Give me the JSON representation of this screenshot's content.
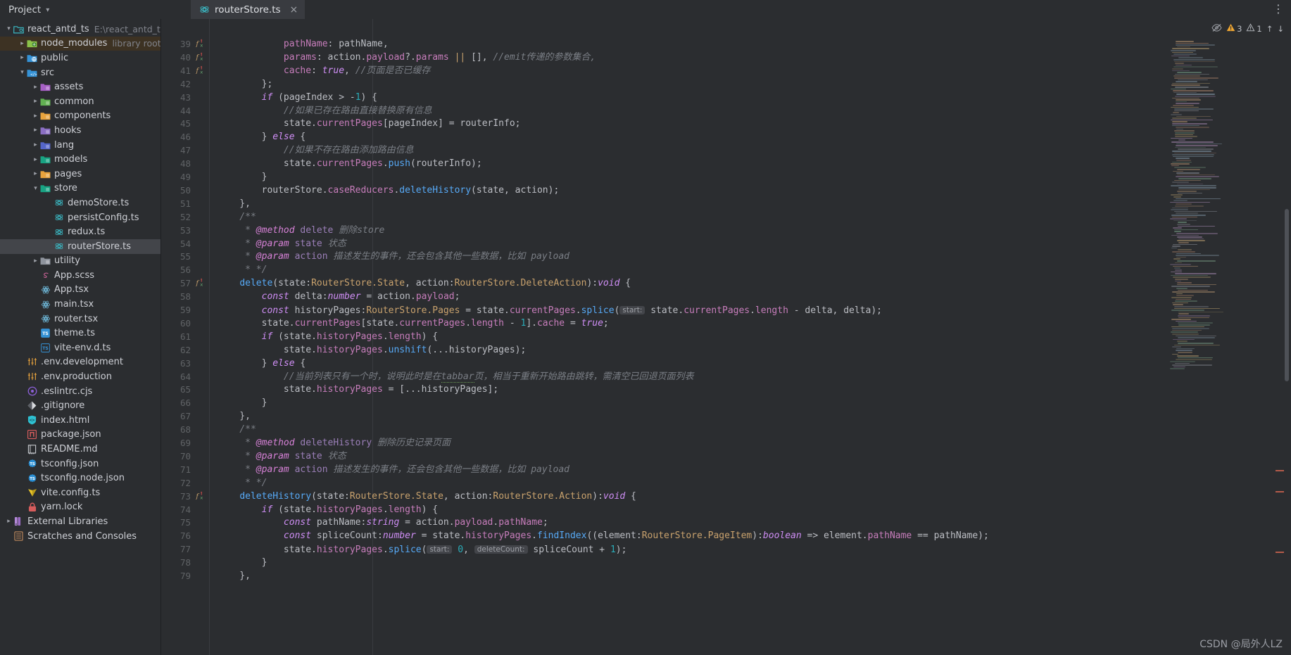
{
  "window": {
    "project_panel_title": "Project",
    "project_panel_chevron": "chevron-down",
    "menu_icon": "vertical-dots"
  },
  "tab": {
    "label": "routerStore.ts",
    "close_label": "×",
    "icon": "redux-icon"
  },
  "sidebar": {
    "items": [
      {
        "label": "react_antd_ts",
        "sub": "E:\\react_antd_ts",
        "depth": 0,
        "arrow": "open",
        "icon": "project-root",
        "color": "#3bb8c3",
        "state": ""
      },
      {
        "label": "node_modules",
        "sub": "library root",
        "depth": 1,
        "arrow": "closed",
        "icon": "folder-node",
        "color": "#8cc24a",
        "state": "hl-brown"
      },
      {
        "label": "public",
        "sub": "",
        "depth": 1,
        "arrow": "closed",
        "icon": "folder-public",
        "color": "#3592d6",
        "state": ""
      },
      {
        "label": "src",
        "sub": "",
        "depth": 1,
        "arrow": "open",
        "icon": "folder-src",
        "color": "#3592d6",
        "state": ""
      },
      {
        "label": "assets",
        "sub": "",
        "depth": 2,
        "arrow": "closed",
        "icon": "folder",
        "color": "#a660c4",
        "state": ""
      },
      {
        "label": "common",
        "sub": "",
        "depth": 2,
        "arrow": "closed",
        "icon": "folder",
        "color": "#62b152",
        "state": ""
      },
      {
        "label": "components",
        "sub": "",
        "depth": 2,
        "arrow": "closed",
        "icon": "folder",
        "color": "#e8a33d",
        "state": ""
      },
      {
        "label": "hooks",
        "sub": "",
        "depth": 2,
        "arrow": "closed",
        "icon": "folder",
        "color": "#8b6fc4",
        "state": ""
      },
      {
        "label": "lang",
        "sub": "",
        "depth": 2,
        "arrow": "closed",
        "icon": "folder",
        "color": "#5566c9",
        "state": ""
      },
      {
        "label": "models",
        "sub": "",
        "depth": 2,
        "arrow": "closed",
        "icon": "folder",
        "color": "#18a383",
        "state": ""
      },
      {
        "label": "pages",
        "sub": "",
        "depth": 2,
        "arrow": "closed",
        "icon": "folder",
        "color": "#e8a33d",
        "state": ""
      },
      {
        "label": "store",
        "sub": "",
        "depth": 2,
        "arrow": "open",
        "icon": "folder",
        "color": "#18a383",
        "state": ""
      },
      {
        "label": "demoStore.ts",
        "sub": "",
        "depth": 3,
        "arrow": "none",
        "icon": "redux-icon",
        "color": "#3bb8c3",
        "state": ""
      },
      {
        "label": "persistConfig.ts",
        "sub": "",
        "depth": 3,
        "arrow": "none",
        "icon": "redux-icon",
        "color": "#3bb8c3",
        "state": ""
      },
      {
        "label": "redux.ts",
        "sub": "",
        "depth": 3,
        "arrow": "none",
        "icon": "redux-icon",
        "color": "#3bb8c3",
        "state": ""
      },
      {
        "label": "routerStore.ts",
        "sub": "",
        "depth": 3,
        "arrow": "none",
        "icon": "redux-icon",
        "color": "#3bb8c3",
        "state": "selected"
      },
      {
        "label": "utility",
        "sub": "",
        "depth": 2,
        "arrow": "closed",
        "icon": "folder",
        "color": "#8e939c",
        "state": ""
      },
      {
        "label": "App.scss",
        "sub": "",
        "depth": 2,
        "arrow": "none",
        "icon": "sass-icon",
        "color": "#cf649a",
        "state": ""
      },
      {
        "label": "App.tsx",
        "sub": "",
        "depth": 2,
        "arrow": "none",
        "icon": "react-icon",
        "color": "#6fb8d9",
        "state": ""
      },
      {
        "label": "main.tsx",
        "sub": "",
        "depth": 2,
        "arrow": "none",
        "icon": "react-icon",
        "color": "#6fb8d9",
        "state": ""
      },
      {
        "label": "router.tsx",
        "sub": "",
        "depth": 2,
        "arrow": "none",
        "icon": "react-icon",
        "color": "#6fb8d9",
        "state": ""
      },
      {
        "label": "theme.ts",
        "sub": "",
        "depth": 2,
        "arrow": "none",
        "icon": "ts-icon",
        "color": "#3592d6",
        "state": ""
      },
      {
        "label": "vite-env.d.ts",
        "sub": "",
        "depth": 2,
        "arrow": "none",
        "icon": "ts-decl-icon",
        "color": "#3592d6",
        "state": ""
      },
      {
        "label": ".env.development",
        "sub": "",
        "depth": 1,
        "arrow": "none",
        "icon": "env-icon",
        "color": "#e8a33d",
        "state": ""
      },
      {
        "label": ".env.production",
        "sub": "",
        "depth": 1,
        "arrow": "none",
        "icon": "env-icon",
        "color": "#e8a33d",
        "state": ""
      },
      {
        "label": ".eslintrc.cjs",
        "sub": "",
        "depth": 1,
        "arrow": "none",
        "icon": "eslint-icon",
        "color": "#8b5fd6",
        "state": ""
      },
      {
        "label": ".gitignore",
        "sub": "",
        "depth": 1,
        "arrow": "none",
        "icon": "git-icon",
        "color": "#d7d9dd",
        "state": ""
      },
      {
        "label": "index.html",
        "sub": "",
        "depth": 1,
        "arrow": "none",
        "icon": "html-icon",
        "color": "#2ebfd0",
        "state": ""
      },
      {
        "label": "package.json",
        "sub": "",
        "depth": 1,
        "arrow": "none",
        "icon": "npm-icon",
        "color": "#d65c5c",
        "state": ""
      },
      {
        "label": "README.md",
        "sub": "",
        "depth": 1,
        "arrow": "none",
        "icon": "readme-icon",
        "color": "#c6c9ce",
        "state": ""
      },
      {
        "label": "tsconfig.json",
        "sub": "",
        "depth": 1,
        "arrow": "none",
        "icon": "tsconfig-icon",
        "color": "#2a8fd4",
        "state": ""
      },
      {
        "label": "tsconfig.node.json",
        "sub": "",
        "depth": 1,
        "arrow": "none",
        "icon": "tsconfig-icon",
        "color": "#2a8fd4",
        "state": ""
      },
      {
        "label": "vite.config.ts",
        "sub": "",
        "depth": 1,
        "arrow": "none",
        "icon": "vite-icon",
        "color": "#e6c229",
        "state": ""
      },
      {
        "label": "yarn.lock",
        "sub": "",
        "depth": 1,
        "arrow": "none",
        "icon": "lock-icon",
        "color": "#d65c5c",
        "state": ""
      },
      {
        "label": "External Libraries",
        "sub": "",
        "depth": 0,
        "arrow": "closed",
        "icon": "library-icon",
        "color": "#b488d9",
        "state": ""
      },
      {
        "label": "Scratches and Consoles",
        "sub": "",
        "depth": 0,
        "arrow": "none",
        "icon": "scratch-icon",
        "color": "#c08a5e",
        "state": ""
      }
    ]
  },
  "inspection": {
    "eye_icon": "eye-off-icon",
    "warning_icon": "warning-triangle-icon",
    "warning_count": "3",
    "weak_warning_icon": "weak-warning-icon",
    "weak_warning_count": "1",
    "up_arrow": "↑",
    "down_arrow": "↓"
  },
  "watermark": "CSDN @局外人LZ",
  "editor": {
    "first_line": 39,
    "lines": [
      {
        "n": 39,
        "mark": "fx",
        "html": "<span class='pln'>            </span><span class='prop'>pathName</span><span class='pln'>: pathName,</span>"
      },
      {
        "n": 40,
        "mark": "fx",
        "html": "<span class='pln'>            </span><span class='prop'>params</span><span class='pln'>: action.</span><span class='prop'>payload</span><span class='pln'>?.</span><span class='prop'>params</span><span class='pln'> </span><span class='var'>||</span><span class='pln'> [], </span><span class='com'>//emit传递的参数集合,</span>"
      },
      {
        "n": 41,
        "mark": "fx",
        "html": "<span class='pln'>            </span><span class='prop'>cache</span><span class='pln'>: </span><span class='kw'>true</span><span class='pln'>, </span><span class='com'>//页面是否已缓存</span>"
      },
      {
        "n": 42,
        "mark": "",
        "html": "<span class='pln'>        };</span>"
      },
      {
        "n": 43,
        "mark": "",
        "html": "<span class='pln'>        </span><span class='kw'>if</span><span class='pln'> (pageIndex &gt; -</span><span class='num2'>1</span><span class='pln'>) {</span>"
      },
      {
        "n": 44,
        "mark": "",
        "html": "<span class='pln'>            </span><span class='com'>//如果已存在路由直接替换原有信息</span>"
      },
      {
        "n": 45,
        "mark": "",
        "html": "<span class='pln'>            state.</span><span class='prop'>currentPages</span><span class='pln'>[pageIndex] = routerInfo;</span>"
      },
      {
        "n": 46,
        "mark": "",
        "html": "<span class='pln'>        } </span><span class='kw'>else</span><span class='pln'> {</span>"
      },
      {
        "n": 47,
        "mark": "",
        "html": "<span class='pln'>            </span><span class='com'>//如果不存在路由添加路由信息</span>"
      },
      {
        "n": 48,
        "mark": "",
        "html": "<span class='pln'>            state.</span><span class='prop'>currentPages</span><span class='pln'>.</span><span class='fn'>push</span><span class='pln'>(routerInfo);</span>"
      },
      {
        "n": 49,
        "mark": "",
        "html": "<span class='pln'>        }</span>"
      },
      {
        "n": 50,
        "mark": "",
        "html": "<span class='pln'>        routerStore.</span><span class='prop'>caseReducers</span><span class='pln'>.</span><span class='fn'>deleteHistory</span><span class='pln'>(state, action);</span>"
      },
      {
        "n": 51,
        "mark": "",
        "html": "<span class='pln'>    },</span>"
      },
      {
        "n": 52,
        "mark": "",
        "html": "<span class='com'>    /**</span>"
      },
      {
        "n": 53,
        "mark": "",
        "html": "<span class='com'>     * </span><span class='jdoc-tag'>@method</span><span class='jdoc-txt'> delete </span><span class='jdoc-desc'>删除store</span>"
      },
      {
        "n": 54,
        "mark": "",
        "html": "<span class='com'>     * </span><span class='jdoc-tag'>@param</span><span class='jdoc-txt'> state </span><span class='jdoc-desc'>状态</span>"
      },
      {
        "n": 55,
        "mark": "",
        "html": "<span class='com'>     * </span><span class='jdoc-tag'>@param</span><span class='jdoc-txt'> action </span><span class='jdoc-desc'>描述发生的事件，还会包含其他一些数据，比如 payload</span>"
      },
      {
        "n": 56,
        "mark": "",
        "html": "<span class='com'>     * */</span>"
      },
      {
        "n": 57,
        "mark": "fx",
        "html": "<span class='pln'>    </span><span class='fn'>delete</span><span class='pln'>(state:</span><span class='typ'>RouterStore.State</span><span class='pln'>, action:</span><span class='typ'>RouterStore.DeleteAction</span><span class='pln'>):</span><span class='kw'>void</span><span class='pln'> {</span>"
      },
      {
        "n": 58,
        "mark": "",
        "html": "<span class='pln'>        </span><span class='kw'>const</span><span class='pln'> delta:</span><span class='kw'>number</span><span class='pln'> = action.</span><span class='prop'>payload</span><span class='pln'>;</span>"
      },
      {
        "n": 59,
        "mark": "",
        "html": "<span class='pln'>        </span><span class='kw'>const</span><span class='pln'> historyPages:</span><span class='typ'>RouterStore.Pages</span><span class='pln'> = state.</span><span class='prop'>currentPages</span><span class='pln'>.</span><span class='fn'>splice</span><span class='pln'>(</span><span class='hint'>start:</span><span class='pln'> state.</span><span class='prop'>currentPages</span><span class='pln'>.</span><span class='prop'>length</span><span class='pln'> - delta, delta);</span>"
      },
      {
        "n": 60,
        "mark": "",
        "html": "<span class='pln'>        state.</span><span class='prop'>currentPages</span><span class='pln'>[state.</span><span class='prop'>currentPages</span><span class='pln'>.</span><span class='prop'>length</span><span class='pln'> - </span><span class='num2'>1</span><span class='pln'>].</span><span class='prop'>cache</span><span class='pln'> = </span><span class='kw'>true</span><span class='pln'>;</span>"
      },
      {
        "n": 61,
        "mark": "",
        "html": "<span class='pln'>        </span><span class='kw'>if</span><span class='pln'> (state.</span><span class='prop'>historyPages</span><span class='pln'>.</span><span class='prop'>length</span><span class='pln'>) {</span>"
      },
      {
        "n": 62,
        "mark": "",
        "html": "<span class='pln'>            state.</span><span class='prop'>historyPages</span><span class='pln'>.</span><span class='fn'>unshift</span><span class='pln'>(...historyPages);</span>"
      },
      {
        "n": 63,
        "mark": "",
        "html": "<span class='pln'>        } </span><span class='kw'>else</span><span class='pln'> {</span>"
      },
      {
        "n": 64,
        "mark": "",
        "html": "<span class='pln'>            </span><span class='com'>//当前列表只有一个时，说明此时是在<span class='squig'>tabbar</span>页，相当于重新开始路由跳转，需清空已回退页面列表</span>"
      },
      {
        "n": 65,
        "mark": "",
        "html": "<span class='pln'>            state.</span><span class='prop'>historyPages</span><span class='pln'> = [...historyPages];</span>"
      },
      {
        "n": 66,
        "mark": "",
        "html": "<span class='pln'>        }</span>"
      },
      {
        "n": 67,
        "mark": "",
        "html": "<span class='pln'>    },</span>"
      },
      {
        "n": 68,
        "mark": "",
        "html": "<span class='com'>    /**</span>"
      },
      {
        "n": 69,
        "mark": "",
        "html": "<span class='com'>     * </span><span class='jdoc-tag'>@method</span><span class='jdoc-txt'> deleteHistory </span><span class='jdoc-desc'>删除历史记录页面</span>"
      },
      {
        "n": 70,
        "mark": "",
        "html": "<span class='com'>     * </span><span class='jdoc-tag'>@param</span><span class='jdoc-txt'> state </span><span class='jdoc-desc'>状态</span>"
      },
      {
        "n": 71,
        "mark": "",
        "html": "<span class='com'>     * </span><span class='jdoc-tag'>@param</span><span class='jdoc-txt'> action </span><span class='jdoc-desc'>描述发生的事件，还会包含其他一些数据，比如 payload</span>"
      },
      {
        "n": 72,
        "mark": "",
        "html": "<span class='com'>     * */</span>"
      },
      {
        "n": 73,
        "mark": "fx",
        "html": "<span class='pln'>    </span><span class='fn'>deleteHistory</span><span class='pln'>(state:</span><span class='typ'>RouterStore.State</span><span class='pln'>, action:</span><span class='typ'>RouterStore.Action</span><span class='pln'>):</span><span class='kw'>void</span><span class='pln'> {</span>"
      },
      {
        "n": 74,
        "mark": "",
        "html": "<span class='pln'>        </span><span class='kw'>if</span><span class='pln'> (state.</span><span class='prop'>historyPages</span><span class='pln'>.</span><span class='prop'>length</span><span class='pln'>) {</span>"
      },
      {
        "n": 75,
        "mark": "",
        "html": "<span class='pln'>            </span><span class='kw'>const</span><span class='pln'> pathName:</span><span class='kw'>string</span><span class='pln'> = action.</span><span class='prop'>payload</span><span class='pln'>.</span><span class='prop'>pathName</span><span class='pln'>;</span>"
      },
      {
        "n": 76,
        "mark": "",
        "html": "<span class='pln'>            </span><span class='kw'>const</span><span class='pln'> spliceCount:</span><span class='kw'>number</span><span class='pln'> = state.</span><span class='prop'>historyPages</span><span class='pln'>.</span><span class='fn'>findIndex</span><span class='pln'>((element:</span><span class='typ'>RouterStore.PageItem</span><span class='pln'>):</span><span class='kw'>boolean</span><span class='pln'> =&gt; element.</span><span class='prop'>pathName</span><span class='pln'> == pathName);</span>"
      },
      {
        "n": 77,
        "mark": "",
        "html": "<span class='pln'>            state.</span><span class='prop'>historyPages</span><span class='pln'>.</span><span class='fn'>splice</span><span class='pln'>(</span><span class='hint'>start:</span><span class='pln'> </span><span class='num2'>0</span><span class='pln'>, </span><span class='hint'>deleteCount:</span><span class='pln'> spliceCount + </span><span class='num2'>1</span><span class='pln'>);</span>"
      },
      {
        "n": 78,
        "mark": "",
        "html": "<span class='pln'>        }</span>"
      },
      {
        "n": 79,
        "mark": "",
        "html": "<span class='pln'>    },</span>"
      }
    ]
  }
}
